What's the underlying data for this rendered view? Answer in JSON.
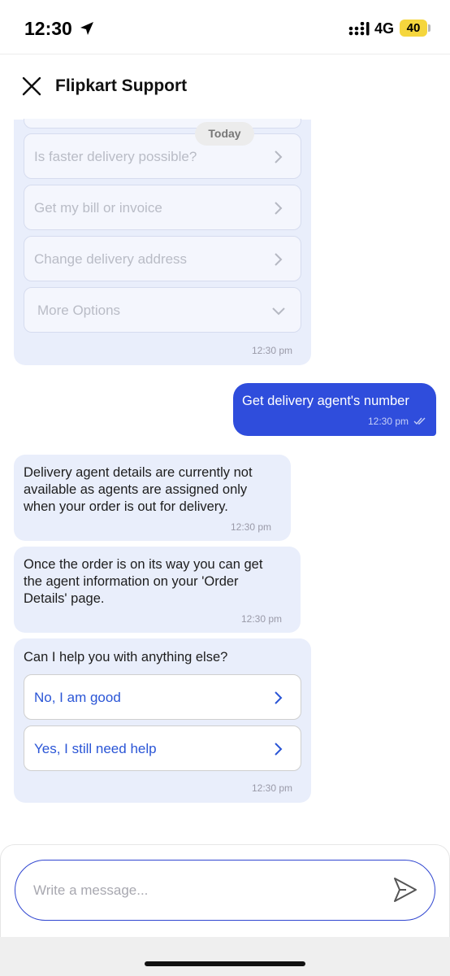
{
  "status_bar": {
    "time": "12:30",
    "network": "4G",
    "battery": "40"
  },
  "header": {
    "title": "Flipkart Support"
  },
  "chat": {
    "date_pill": "Today",
    "menu_options": [
      {
        "label": "Is faster delivery possible?",
        "icon": "chevron-right-icon"
      },
      {
        "label": "Get my bill or invoice",
        "icon": "chevron-right-icon"
      },
      {
        "label": "Change delivery address",
        "icon": "chevron-right-icon"
      },
      {
        "label": "More Options",
        "icon": "chevron-down-icon"
      }
    ],
    "menu_time": "12:30 pm",
    "user_message": {
      "text": "Get delivery agent's number",
      "time": "12:30 pm",
      "status": "delivered"
    },
    "bot_messages": [
      {
        "lines": [
          "Delivery agent details are currently not",
          "available as agents are assigned only",
          "when your order is out for delivery."
        ],
        "time": "12:30 pm"
      },
      {
        "lines": [
          "Once the order is on its way you can get",
          "the agent information on your 'Order",
          "Details' page."
        ],
        "time": "12:30 pm"
      }
    ],
    "help_prompt": {
      "text": "Can I help you with anything else?",
      "time": "12:30 pm"
    },
    "help_options": [
      {
        "label": "No, I am good"
      },
      {
        "label": "Yes, I still need help"
      }
    ]
  },
  "composer": {
    "placeholder": "Write a message..."
  },
  "colors": {
    "accent": "#2F4DDC",
    "bot_bubble": "#E9EEFB",
    "link": "#2A55D6"
  }
}
